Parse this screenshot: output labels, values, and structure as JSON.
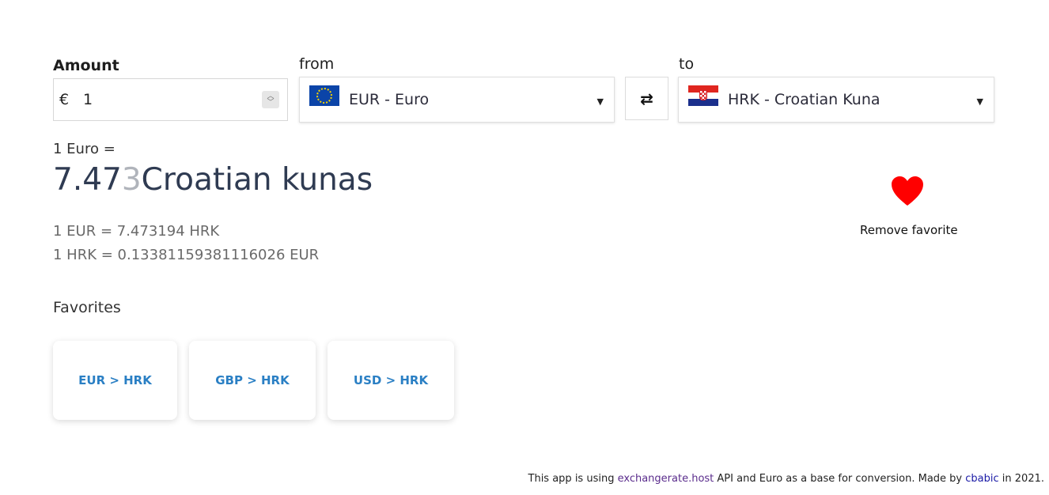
{
  "form": {
    "amount_label": "Amount",
    "from_label": "from",
    "to_label": "to",
    "currency_symbol": "€",
    "amount_value": "1",
    "from_value": "EUR - Euro",
    "to_value": "HRK - Croatian Kuna",
    "swap_glyph": "⇄",
    "caret_glyph": "▼"
  },
  "result": {
    "base_line": "1 Euro =",
    "value_main": "7.47",
    "value_dim": "3",
    "currency_name": "Croatian kunas",
    "rate_eur_hrk": "1 EUR = 7.473194 HRK",
    "rate_hrk_eur": "1 HRK = 0.13381159381116026 EUR"
  },
  "favorite_toggle": {
    "label": "Remove favorite",
    "icon": "heart-icon",
    "color": "#ff0000"
  },
  "favorites": {
    "title": "Favorites",
    "items": [
      {
        "label": "EUR > HRK"
      },
      {
        "label": "GBP > HRK"
      },
      {
        "label": "USD > HRK"
      }
    ]
  },
  "footer": {
    "prefix": "This app is using ",
    "api_link": "exchangerate.host",
    "middle": " API and Euro as a base for conversion. Made by ",
    "author_link": "cbabic",
    "suffix": " in 2021."
  },
  "colors": {
    "accent": "#2a7fc4",
    "title": "#2f3b52",
    "heart": "#ff0000"
  }
}
